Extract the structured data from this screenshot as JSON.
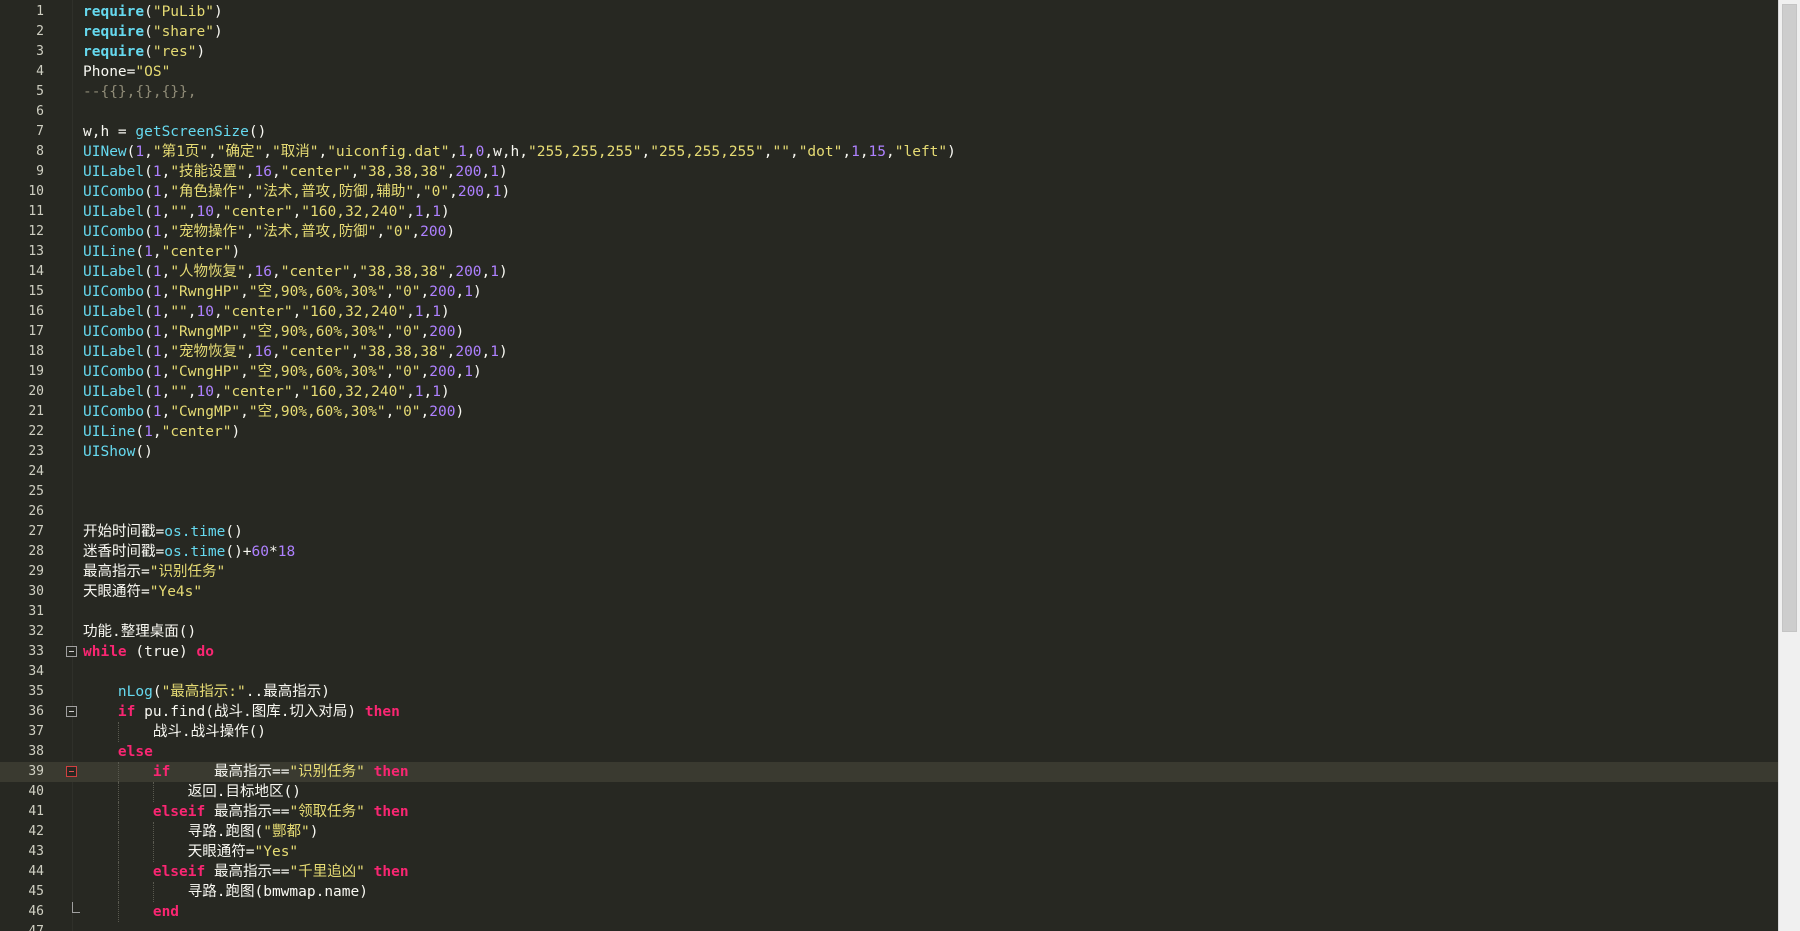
{
  "editor": {
    "language": "lua",
    "current_line": 39,
    "line_numbers": [
      "1",
      "2",
      "3",
      "4",
      "5",
      "6",
      "7",
      "8",
      "9",
      "10",
      "11",
      "12",
      "13",
      "14",
      "15",
      "16",
      "17",
      "18",
      "19",
      "20",
      "21",
      "22",
      "23",
      "24",
      "25",
      "26",
      "27",
      "28",
      "29",
      "30",
      "31",
      "32",
      "33",
      "34",
      "35",
      "36",
      "37",
      "38",
      "39",
      "40",
      "41",
      "42",
      "43",
      "44",
      "45",
      "46",
      "47"
    ],
    "lines": [
      [
        [
          "rq",
          "require"
        ],
        [
          "o",
          "("
        ],
        [
          "s",
          "\"PuLib\""
        ],
        [
          "o",
          ")"
        ]
      ],
      [
        [
          "rq",
          "require"
        ],
        [
          "o",
          "("
        ],
        [
          "s",
          "\"share\""
        ],
        [
          "o",
          ")"
        ]
      ],
      [
        [
          "rq",
          "require"
        ],
        [
          "o",
          "("
        ],
        [
          "s",
          "\"res\""
        ],
        [
          "o",
          ")"
        ]
      ],
      [
        [
          "o",
          "Phone="
        ],
        [
          "s",
          "\"OS\""
        ]
      ],
      [
        [
          "c",
          "--{{},{},{}},"
        ]
      ],
      [],
      [
        [
          "o",
          "w,h = "
        ],
        [
          "b",
          "getScreenSize"
        ],
        [
          "o",
          "()"
        ]
      ],
      [
        [
          "b",
          "UINew"
        ],
        [
          "o",
          "("
        ],
        [
          "n",
          "1"
        ],
        [
          "o",
          ","
        ],
        [
          "s",
          "\"第1页\""
        ],
        [
          "o",
          ","
        ],
        [
          "s",
          "\"确定\""
        ],
        [
          "o",
          ","
        ],
        [
          "s",
          "\"取消\""
        ],
        [
          "o",
          ","
        ],
        [
          "s",
          "\"uiconfig.dat\""
        ],
        [
          "o",
          ","
        ],
        [
          "n",
          "1"
        ],
        [
          "o",
          ","
        ],
        [
          "n",
          "0"
        ],
        [
          "o",
          ",w,h,"
        ],
        [
          "s",
          "\"255,255,255\""
        ],
        [
          "o",
          ","
        ],
        [
          "s",
          "\"255,255,255\""
        ],
        [
          "o",
          ","
        ],
        [
          "s",
          "\"\""
        ],
        [
          "o",
          ","
        ],
        [
          "s",
          "\"dot\""
        ],
        [
          "o",
          ","
        ],
        [
          "n",
          "1"
        ],
        [
          "o",
          ","
        ],
        [
          "n",
          "15"
        ],
        [
          "o",
          ","
        ],
        [
          "s",
          "\"left\""
        ],
        [
          "o",
          ")"
        ]
      ],
      [
        [
          "b",
          "UILabel"
        ],
        [
          "o",
          "("
        ],
        [
          "n",
          "1"
        ],
        [
          "o",
          ","
        ],
        [
          "s",
          "\"技能设置\""
        ],
        [
          "o",
          ","
        ],
        [
          "n",
          "16"
        ],
        [
          "o",
          ","
        ],
        [
          "s",
          "\"center\""
        ],
        [
          "o",
          ","
        ],
        [
          "s",
          "\"38,38,38\""
        ],
        [
          "o",
          ","
        ],
        [
          "n",
          "200"
        ],
        [
          "o",
          ","
        ],
        [
          "n",
          "1"
        ],
        [
          "o",
          ")"
        ]
      ],
      [
        [
          "b",
          "UICombo"
        ],
        [
          "o",
          "("
        ],
        [
          "n",
          "1"
        ],
        [
          "o",
          ","
        ],
        [
          "s",
          "\"角色操作\""
        ],
        [
          "o",
          ","
        ],
        [
          "s",
          "\"法术,普攻,防御,辅助\""
        ],
        [
          "o",
          ","
        ],
        [
          "s",
          "\"0\""
        ],
        [
          "o",
          ","
        ],
        [
          "n",
          "200"
        ],
        [
          "o",
          ","
        ],
        [
          "n",
          "1"
        ],
        [
          "o",
          ")"
        ]
      ],
      [
        [
          "b",
          "UILabel"
        ],
        [
          "o",
          "("
        ],
        [
          "n",
          "1"
        ],
        [
          "o",
          ","
        ],
        [
          "s",
          "\"\""
        ],
        [
          "o",
          ","
        ],
        [
          "n",
          "10"
        ],
        [
          "o",
          ","
        ],
        [
          "s",
          "\"center\""
        ],
        [
          "o",
          ","
        ],
        [
          "s",
          "\"160,32,240\""
        ],
        [
          "o",
          ","
        ],
        [
          "n",
          "1"
        ],
        [
          "o",
          ","
        ],
        [
          "n",
          "1"
        ],
        [
          "o",
          ")"
        ]
      ],
      [
        [
          "b",
          "UICombo"
        ],
        [
          "o",
          "("
        ],
        [
          "n",
          "1"
        ],
        [
          "o",
          ","
        ],
        [
          "s",
          "\"宠物操作\""
        ],
        [
          "o",
          ","
        ],
        [
          "s",
          "\"法术,普攻,防御\""
        ],
        [
          "o",
          ","
        ],
        [
          "s",
          "\"0\""
        ],
        [
          "o",
          ","
        ],
        [
          "n",
          "200"
        ],
        [
          "o",
          ")"
        ]
      ],
      [
        [
          "b",
          "UILine"
        ],
        [
          "o",
          "("
        ],
        [
          "n",
          "1"
        ],
        [
          "o",
          ","
        ],
        [
          "s",
          "\"center\""
        ],
        [
          "o",
          ")"
        ]
      ],
      [
        [
          "b",
          "UILabel"
        ],
        [
          "o",
          "("
        ],
        [
          "n",
          "1"
        ],
        [
          "o",
          ","
        ],
        [
          "s",
          "\"人物恢复\""
        ],
        [
          "o",
          ","
        ],
        [
          "n",
          "16"
        ],
        [
          "o",
          ","
        ],
        [
          "s",
          "\"center\""
        ],
        [
          "o",
          ","
        ],
        [
          "s",
          "\"38,38,38\""
        ],
        [
          "o",
          ","
        ],
        [
          "n",
          "200"
        ],
        [
          "o",
          ","
        ],
        [
          "n",
          "1"
        ],
        [
          "o",
          ")"
        ]
      ],
      [
        [
          "b",
          "UICombo"
        ],
        [
          "o",
          "("
        ],
        [
          "n",
          "1"
        ],
        [
          "o",
          ","
        ],
        [
          "s",
          "\"RwngHP\""
        ],
        [
          "o",
          ","
        ],
        [
          "s",
          "\"空,90%,60%,30%\""
        ],
        [
          "o",
          ","
        ],
        [
          "s",
          "\"0\""
        ],
        [
          "o",
          ","
        ],
        [
          "n",
          "200"
        ],
        [
          "o",
          ","
        ],
        [
          "n",
          "1"
        ],
        [
          "o",
          ")"
        ]
      ],
      [
        [
          "b",
          "UILabel"
        ],
        [
          "o",
          "("
        ],
        [
          "n",
          "1"
        ],
        [
          "o",
          ","
        ],
        [
          "s",
          "\"\""
        ],
        [
          "o",
          ","
        ],
        [
          "n",
          "10"
        ],
        [
          "o",
          ","
        ],
        [
          "s",
          "\"center\""
        ],
        [
          "o",
          ","
        ],
        [
          "s",
          "\"160,32,240\""
        ],
        [
          "o",
          ","
        ],
        [
          "n",
          "1"
        ],
        [
          "o",
          ","
        ],
        [
          "n",
          "1"
        ],
        [
          "o",
          ")"
        ]
      ],
      [
        [
          "b",
          "UICombo"
        ],
        [
          "o",
          "("
        ],
        [
          "n",
          "1"
        ],
        [
          "o",
          ","
        ],
        [
          "s",
          "\"RwngMP\""
        ],
        [
          "o",
          ","
        ],
        [
          "s",
          "\"空,90%,60%,30%\""
        ],
        [
          "o",
          ","
        ],
        [
          "s",
          "\"0\""
        ],
        [
          "o",
          ","
        ],
        [
          "n",
          "200"
        ],
        [
          "o",
          ")"
        ]
      ],
      [
        [
          "b",
          "UILabel"
        ],
        [
          "o",
          "("
        ],
        [
          "n",
          "1"
        ],
        [
          "o",
          ","
        ],
        [
          "s",
          "\"宠物恢复\""
        ],
        [
          "o",
          ","
        ],
        [
          "n",
          "16"
        ],
        [
          "o",
          ","
        ],
        [
          "s",
          "\"center\""
        ],
        [
          "o",
          ","
        ],
        [
          "s",
          "\"38,38,38\""
        ],
        [
          "o",
          ","
        ],
        [
          "n",
          "200"
        ],
        [
          "o",
          ","
        ],
        [
          "n",
          "1"
        ],
        [
          "o",
          ")"
        ]
      ],
      [
        [
          "b",
          "UICombo"
        ],
        [
          "o",
          "("
        ],
        [
          "n",
          "1"
        ],
        [
          "o",
          ","
        ],
        [
          "s",
          "\"CwngHP\""
        ],
        [
          "o",
          ","
        ],
        [
          "s",
          "\"空,90%,60%,30%\""
        ],
        [
          "o",
          ","
        ],
        [
          "s",
          "\"0\""
        ],
        [
          "o",
          ","
        ],
        [
          "n",
          "200"
        ],
        [
          "o",
          ","
        ],
        [
          "n",
          "1"
        ],
        [
          "o",
          ")"
        ]
      ],
      [
        [
          "b",
          "UILabel"
        ],
        [
          "o",
          "("
        ],
        [
          "n",
          "1"
        ],
        [
          "o",
          ","
        ],
        [
          "s",
          "\"\""
        ],
        [
          "o",
          ","
        ],
        [
          "n",
          "10"
        ],
        [
          "o",
          ","
        ],
        [
          "s",
          "\"center\""
        ],
        [
          "o",
          ","
        ],
        [
          "s",
          "\"160,32,240\""
        ],
        [
          "o",
          ","
        ],
        [
          "n",
          "1"
        ],
        [
          "o",
          ","
        ],
        [
          "n",
          "1"
        ],
        [
          "o",
          ")"
        ]
      ],
      [
        [
          "b",
          "UICombo"
        ],
        [
          "o",
          "("
        ],
        [
          "n",
          "1"
        ],
        [
          "o",
          ","
        ],
        [
          "s",
          "\"CwngMP\""
        ],
        [
          "o",
          ","
        ],
        [
          "s",
          "\"空,90%,60%,30%\""
        ],
        [
          "o",
          ","
        ],
        [
          "s",
          "\"0\""
        ],
        [
          "o",
          ","
        ],
        [
          "n",
          "200"
        ],
        [
          "o",
          ")"
        ]
      ],
      [
        [
          "b",
          "UILine"
        ],
        [
          "o",
          "("
        ],
        [
          "n",
          "1"
        ],
        [
          "o",
          ","
        ],
        [
          "s",
          "\"center\""
        ],
        [
          "o",
          ")"
        ]
      ],
      [
        [
          "b",
          "UIShow"
        ],
        [
          "o",
          "()"
        ]
      ],
      [],
      [],
      [],
      [
        [
          "o",
          "开始时间戳="
        ],
        [
          "b",
          "os.time"
        ],
        [
          "o",
          "()"
        ]
      ],
      [
        [
          "o",
          "迷香时间戳="
        ],
        [
          "b",
          "os.time"
        ],
        [
          "o",
          "()+"
        ],
        [
          "n",
          "60"
        ],
        [
          "o",
          "*"
        ],
        [
          "n",
          "18"
        ]
      ],
      [
        [
          "o",
          "最高指示="
        ],
        [
          "s",
          "\"识别任务\""
        ]
      ],
      [
        [
          "o",
          "天眼通符="
        ],
        [
          "s",
          "\"Ye4s\""
        ]
      ],
      [],
      [
        [
          "o",
          "功能.整理桌面()"
        ]
      ],
      [
        [
          "k",
          "while"
        ],
        [
          "o",
          " (true) "
        ],
        [
          "k",
          "do"
        ]
      ],
      [],
      [
        [
          "o",
          "    "
        ],
        [
          "b",
          "nLog"
        ],
        [
          "o",
          "("
        ],
        [
          "s",
          "\"最高指示:\""
        ],
        [
          "o",
          "..最高指示)"
        ]
      ],
      [
        [
          "o",
          "    "
        ],
        [
          "k",
          "if"
        ],
        [
          "o",
          " pu.find(战斗.图库.切入对局) "
        ],
        [
          "k",
          "then"
        ]
      ],
      [
        [
          "o",
          "        战斗.战斗操作()"
        ]
      ],
      [
        [
          "o",
          "    "
        ],
        [
          "k",
          "else"
        ]
      ],
      [
        [
          "o",
          "        "
        ],
        [
          "k",
          "if"
        ],
        [
          "o",
          "     最高指示=="
        ],
        [
          "s",
          "\"识别任务\""
        ],
        [
          "o",
          " "
        ],
        [
          "k",
          "then"
        ]
      ],
      [
        [
          "o",
          "            返回.目标地区()"
        ]
      ],
      [
        [
          "o",
          "        "
        ],
        [
          "k",
          "elseif"
        ],
        [
          "o",
          " 最高指示=="
        ],
        [
          "s",
          "\"领取任务\""
        ],
        [
          "o",
          " "
        ],
        [
          "k",
          "then"
        ]
      ],
      [
        [
          "o",
          "            寻路.跑图("
        ],
        [
          "s",
          "\"酆都\""
        ],
        [
          "o",
          ")"
        ]
      ],
      [
        [
          "o",
          "            天眼通符="
        ],
        [
          "s",
          "\"Yes\""
        ]
      ],
      [
        [
          "o",
          "        "
        ],
        [
          "k",
          "elseif"
        ],
        [
          "o",
          " 最高指示=="
        ],
        [
          "s",
          "\"千里追凶\""
        ],
        [
          "o",
          " "
        ],
        [
          "k",
          "then"
        ]
      ],
      [
        [
          "o",
          "            寻路.跑图(bmwmap.name)"
        ]
      ],
      [
        [
          "o",
          "        "
        ],
        [
          "k",
          "end"
        ]
      ],
      []
    ],
    "fold_markers": {
      "33": "open",
      "36": "open",
      "39": "active"
    },
    "fold_ends": [
      "46"
    ]
  },
  "colors": {
    "background": "#272822",
    "keyword": "#f92672",
    "builtin": "#66d9ef",
    "string": "#e6db74",
    "number": "#ae81ff",
    "comment": "#8e8a76",
    "text": "#f8f8f2",
    "current_line": "#3a3a30"
  },
  "scrollbar": {
    "position": 0,
    "visible_fraction": 0.68
  }
}
